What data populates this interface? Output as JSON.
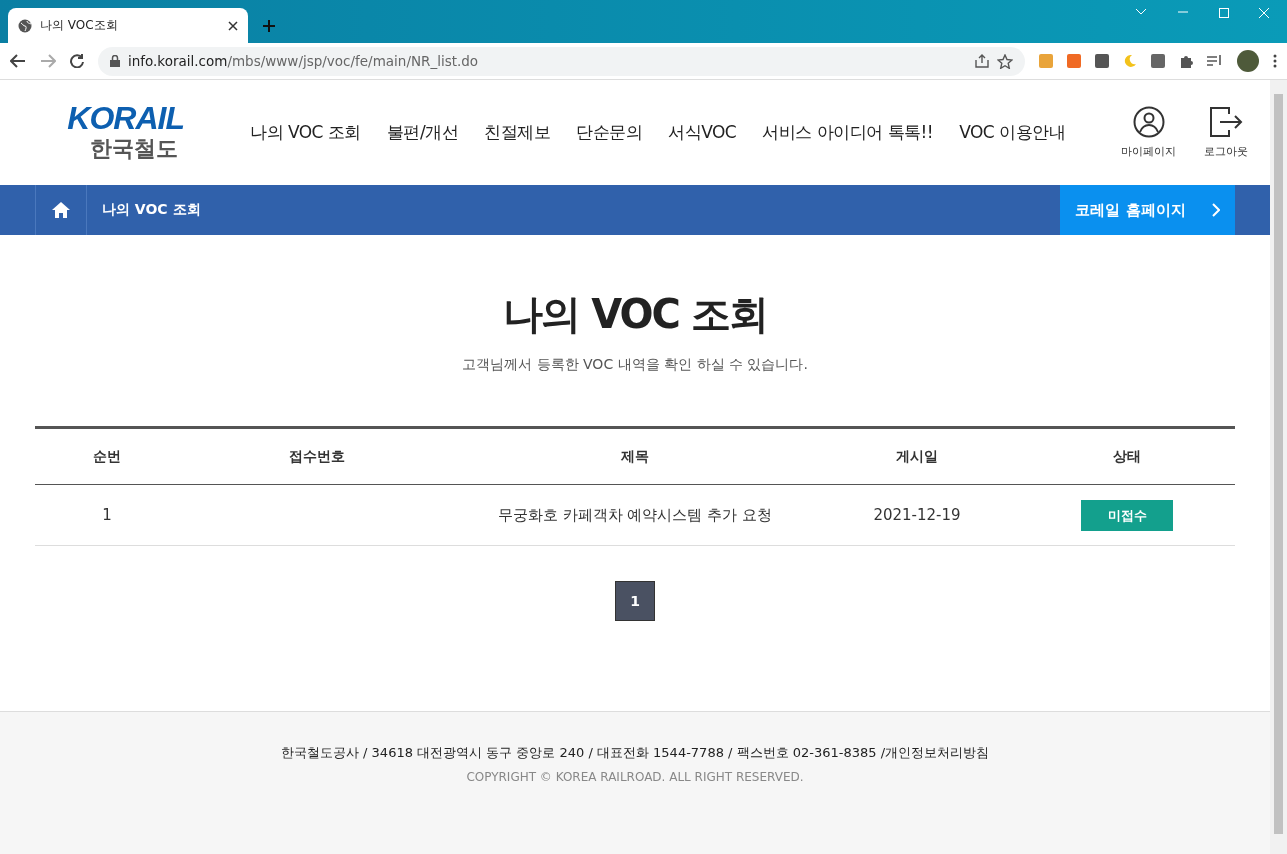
{
  "browser": {
    "tab_title": "나의 VOC조회",
    "url_host": "info.korail.com",
    "url_path": "/mbs/www/jsp/voc/fe/main/NR_list.do"
  },
  "header": {
    "logo_text": "KORAIL",
    "logo_subtitle": "한국철도",
    "nav": [
      {
        "label": "나의 VOC 조회"
      },
      {
        "label": "불편/개선"
      },
      {
        "label": "친절제보"
      },
      {
        "label": "단순문의"
      },
      {
        "label": "서식VOC"
      },
      {
        "label": "서비스 아이디어 톡톡!!"
      },
      {
        "label": "VOC 이용안내"
      }
    ],
    "utility": [
      {
        "kind": "mypage",
        "label": "마이페이지"
      },
      {
        "kind": "logout",
        "label": "로그아웃"
      }
    ]
  },
  "breadcrumb": {
    "current": "나의 VOC 조회",
    "homepage_link": "코레일 홈페이지"
  },
  "page": {
    "title": "나의 VOC 조회",
    "subtitle": "고객님께서 등록한 VOC 내역을 확인 하실 수 있습니다."
  },
  "table": {
    "columns": [
      "순번",
      "접수번호",
      "제목",
      "게시일",
      "상태"
    ],
    "rows": [
      {
        "no": "1",
        "title": "무궁화호 카페객차 예약시스템 추가 요청",
        "date": "2021-12-19",
        "status": "미접수"
      }
    ]
  },
  "pagination": [
    {
      "label": "1",
      "selected": true
    }
  ],
  "footer": {
    "address": "한국철도공사 / 34618 대전광역시 동구 중앙로 240 / 대표전화 1544-7788 / 팩스번호 02-361-8385 /개인정보처리방침",
    "copyright": "COPYRIGHT © KOREA RAILROAD. ALL RIGHT RESERVED."
  }
}
